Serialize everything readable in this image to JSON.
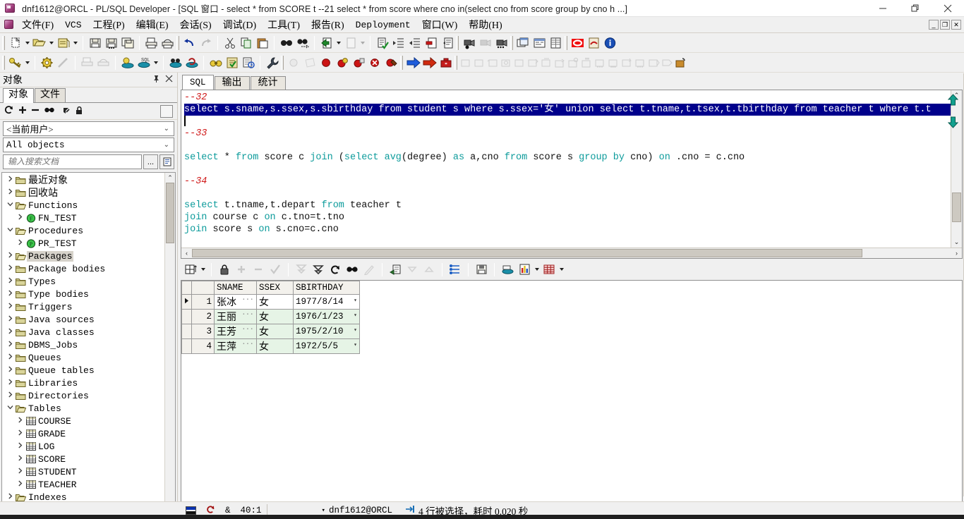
{
  "window": {
    "title": "dnf1612@ORCL - PL/SQL Developer - [SQL 窗口 - select * from SCORE t --21 select * from score where cno in(select cno from score group by cno h ...]",
    "app_icon": "plsql-developer-icon",
    "minimize": "–",
    "maximize": "❐",
    "close": "✕",
    "mdi_restore": "❐",
    "mdi_minimize": "_",
    "mdi_close": "✕"
  },
  "menu": {
    "items": [
      {
        "label": "文件(F)",
        "cjk": true
      },
      {
        "label": "VCS",
        "cjk": false
      },
      {
        "label": "工程(P)",
        "cjk": true
      },
      {
        "label": "编辑(E)",
        "cjk": true
      },
      {
        "label": "会话(S)",
        "cjk": true
      },
      {
        "label": "调试(D)",
        "cjk": true
      },
      {
        "label": "工具(T)",
        "cjk": true
      },
      {
        "label": "报告(R)",
        "cjk": true
      },
      {
        "label": "Deployment",
        "cjk": false
      },
      {
        "label": "窗口(W)",
        "cjk": true
      },
      {
        "label": "帮助(H)",
        "cjk": true
      }
    ]
  },
  "toolbar1": [
    "new-icon",
    "new-dropdown",
    "open-icon",
    "open-dropdown",
    "open-recent-icon",
    "open-recent-dropdown",
    "save-icon",
    "save-as-icon",
    "save-all-icon",
    "print-icon",
    "print-preview-icon",
    "undo-icon",
    "redo-icon",
    "cut-icon",
    "copy-icon",
    "paste-icon",
    "find-icon",
    "find-next-icon",
    "export-icon",
    "export-icon-2",
    "export-dropdown",
    "import-icon",
    "import-dropdown",
    "check-document-icon",
    "indent-icon",
    "outdent-icon",
    "comment-icon",
    "uncomment-icon",
    "record-macro-icon",
    "pause-macro-icon",
    "play-macro-icon",
    "window-list-icon",
    "session-info-icon",
    "grid-view-icon",
    "oracle-icon",
    "pdf-icon",
    "info-icon"
  ],
  "toolbar2": [
    "key-icon",
    "key-dropdown",
    "gear-icon",
    "wand-icon",
    "print-gray-icon",
    "print-setup-gray-icon",
    "explain-plan-icon",
    "sql-db-icon",
    "sql-dropdown",
    "db-browse-icon",
    "db-refresh-icon",
    "binoculars-icon",
    "checklist-icon",
    "report-icon",
    "wrench-icon",
    "step-gray1-icon",
    "step-gray2-icon",
    "breakpoint-red-icon",
    "breakpoint-yellow-icon",
    "breakpoint-stack-icon",
    "breakpoint-x-icon",
    "breakpoint-bug-icon",
    "run-blue-arrow-icon",
    "run-red-arrow-icon",
    "stop-icon",
    "template1-icon",
    "template2-icon",
    "template3-icon",
    "template4-icon",
    "template5-icon",
    "template6-icon",
    "template7-icon",
    "template8-icon",
    "template9-icon",
    "template10-icon",
    "template11-icon",
    "template12-icon",
    "template13-icon",
    "template14-icon",
    "template15-icon",
    "template16-icon",
    "template-config-icon"
  ],
  "object_panel": {
    "caption": "对象",
    "pin_icon": "pin-icon",
    "close_icon": "close-icon",
    "tabs": [
      {
        "label": "对象",
        "active": true
      },
      {
        "label": "文件",
        "active": false
      }
    ],
    "tool_icons": [
      "refresh-icon",
      "add-icon",
      "remove-icon",
      "find-icon",
      "filter-icon",
      "lock-icon"
    ],
    "user_combo": "<当前用户>",
    "type_combo": "All objects",
    "search_placeholder": "输入搜索文档",
    "search_value": "",
    "search_browse_label": "...",
    "search_doc_icon": "document-icon",
    "tree": [
      {
        "label": "最近对象",
        "icon": "folder-icon",
        "depth": 1,
        "expander": "collapsed",
        "cjk": true,
        "selected": false
      },
      {
        "label": "回收站",
        "icon": "folder-icon",
        "depth": 1,
        "expander": "collapsed",
        "cjk": true,
        "selected": false
      },
      {
        "label": "Functions",
        "icon": "folder-open-icon",
        "depth": 1,
        "expander": "expanded",
        "cjk": false,
        "selected": false
      },
      {
        "label": "FN_TEST",
        "icon": "function-icon",
        "depth": 2,
        "expander": "collapsed",
        "cjk": false,
        "selected": false
      },
      {
        "label": "Procedures",
        "icon": "folder-open-icon",
        "depth": 1,
        "expander": "expanded",
        "cjk": false,
        "selected": false
      },
      {
        "label": "PR_TEST",
        "icon": "procedure-icon",
        "depth": 2,
        "expander": "collapsed",
        "cjk": false,
        "selected": false
      },
      {
        "label": "Packages",
        "icon": "folder-open-icon",
        "depth": 1,
        "expander": "collapsed",
        "cjk": false,
        "selected": true
      },
      {
        "label": "Package bodies",
        "icon": "folder-icon",
        "depth": 1,
        "expander": "collapsed",
        "cjk": false,
        "selected": false
      },
      {
        "label": "Types",
        "icon": "folder-icon",
        "depth": 1,
        "expander": "collapsed",
        "cjk": false,
        "selected": false
      },
      {
        "label": "Type bodies",
        "icon": "folder-icon",
        "depth": 1,
        "expander": "collapsed",
        "cjk": false,
        "selected": false
      },
      {
        "label": "Triggers",
        "icon": "folder-icon",
        "depth": 1,
        "expander": "collapsed",
        "cjk": false,
        "selected": false
      },
      {
        "label": "Java sources",
        "icon": "folder-icon",
        "depth": 1,
        "expander": "collapsed",
        "cjk": false,
        "selected": false
      },
      {
        "label": "Java classes",
        "icon": "folder-icon",
        "depth": 1,
        "expander": "collapsed",
        "cjk": false,
        "selected": false
      },
      {
        "label": "DBMS_Jobs",
        "icon": "folder-icon",
        "depth": 1,
        "expander": "collapsed",
        "cjk": false,
        "selected": false
      },
      {
        "label": "Queues",
        "icon": "folder-icon",
        "depth": 1,
        "expander": "collapsed",
        "cjk": false,
        "selected": false
      },
      {
        "label": "Queue tables",
        "icon": "folder-icon",
        "depth": 1,
        "expander": "collapsed",
        "cjk": false,
        "selected": false
      },
      {
        "label": "Libraries",
        "icon": "folder-icon",
        "depth": 1,
        "expander": "collapsed",
        "cjk": false,
        "selected": false
      },
      {
        "label": "Directories",
        "icon": "folder-icon",
        "depth": 1,
        "expander": "collapsed",
        "cjk": false,
        "selected": false
      },
      {
        "label": "Tables",
        "icon": "folder-open-icon",
        "depth": 1,
        "expander": "expanded",
        "cjk": false,
        "selected": false
      },
      {
        "label": "COURSE",
        "icon": "table-icon",
        "depth": 2,
        "expander": "collapsed",
        "cjk": false,
        "selected": false
      },
      {
        "label": "GRADE",
        "icon": "table-icon",
        "depth": 2,
        "expander": "collapsed",
        "cjk": false,
        "selected": false
      },
      {
        "label": "LOG",
        "icon": "table-icon",
        "depth": 2,
        "expander": "collapsed",
        "cjk": false,
        "selected": false
      },
      {
        "label": "SCORE",
        "icon": "table-icon",
        "depth": 2,
        "expander": "collapsed",
        "cjk": false,
        "selected": false
      },
      {
        "label": "STUDENT",
        "icon": "table-icon",
        "depth": 2,
        "expander": "collapsed",
        "cjk": false,
        "selected": false
      },
      {
        "label": "TEACHER",
        "icon": "table-icon",
        "depth": 2,
        "expander": "collapsed",
        "cjk": false,
        "selected": false
      },
      {
        "label": "Indexes",
        "icon": "folder-open-icon",
        "depth": 1,
        "expander": "collapsed",
        "cjk": false,
        "selected": false
      }
    ]
  },
  "editor": {
    "tabs": [
      {
        "label": "SQL",
        "active": true,
        "cjk": false
      },
      {
        "label": "输出",
        "active": false,
        "cjk": true
      },
      {
        "label": "统计",
        "active": false,
        "cjk": true
      }
    ],
    "lines": [
      {
        "type": "comment",
        "text": "--32"
      },
      {
        "type": "selected",
        "text": "select s.sname,s.ssex,s.sbirthday from student s where s.ssex='女' union select t.tname,t.tsex,t.tbirthday from teacher t where t.t"
      },
      {
        "type": "caret",
        "text": ""
      },
      {
        "type": "comment",
        "text": "--33"
      },
      {
        "type": "blank",
        "text": ""
      },
      {
        "type": "sql",
        "text": "select * from score c join (select avg(degree) as a,cno from score s group by cno) on .cno = c.cno"
      },
      {
        "type": "blank",
        "text": ""
      },
      {
        "type": "comment",
        "text": "--34"
      },
      {
        "type": "blank",
        "text": ""
      },
      {
        "type": "sql",
        "text": "select t.tname,t.depart from teacher t"
      },
      {
        "type": "sql",
        "text": "join course c on c.tno=t.tno"
      },
      {
        "type": "sql",
        "text": "join score s on s.cno=c.cno"
      }
    ]
  },
  "grid_toolbar": [
    "grid-size-icon",
    "grid-size-dropdown",
    "lock-icon",
    "insert-row-icon",
    "delete-row-icon",
    "post-changes-icon",
    "export-down-icon",
    "export-up-icon",
    "refresh-icon",
    "find-icon",
    "edit-data-icon",
    "copy-record-icon",
    "sort-desc-icon",
    "sort-asc-icon",
    "column-layout-icon",
    "save-icon",
    "db-icon",
    "chart-icon",
    "chart-dropdown",
    "grid-style-icon",
    "grid-style-dropdown"
  ],
  "results": {
    "columns": [
      "SNAME",
      "SSEX",
      "SBIRTHDAY"
    ],
    "rows": [
      {
        "num": "1",
        "current": true,
        "SNAME": "张冰",
        "SSEX": "女",
        "SBIRTHDAY": "1977/8/14"
      },
      {
        "num": "2",
        "current": false,
        "SNAME": "王丽",
        "SSEX": "女",
        "SBIRTHDAY": "1976/1/23"
      },
      {
        "num": "3",
        "current": false,
        "SNAME": "王芳",
        "SSEX": "女",
        "SBIRTHDAY": "1975/2/10"
      },
      {
        "num": "4",
        "current": false,
        "SNAME": "王萍",
        "SSEX": "女",
        "SBIRTHDAY": "1972/5/5"
      }
    ]
  },
  "side_nav": {
    "up_icon": "scroll-up-arrow-icon",
    "down_icon": "scroll-down-arrow-icon"
  },
  "statusbar": {
    "flag_icon": "estonia-flag-icon",
    "recompile_icon": "recompile-icon",
    "ampersand_icon": "&",
    "cursor_position": "40:1",
    "connection_dropdown_icon": "chevron-down-icon",
    "connection": "dnf1612@ORCL",
    "rows_icon": "rows-icon",
    "rows_message": "4 行被选择，耗时 0.020 秒"
  },
  "colors": {
    "selection_bg": "#00008B",
    "comment": "#d01a1a",
    "keyword": "#0c9b9b",
    "grid_alt_row": "#e6f4e6",
    "panel_bg": "#f0f0f0"
  }
}
